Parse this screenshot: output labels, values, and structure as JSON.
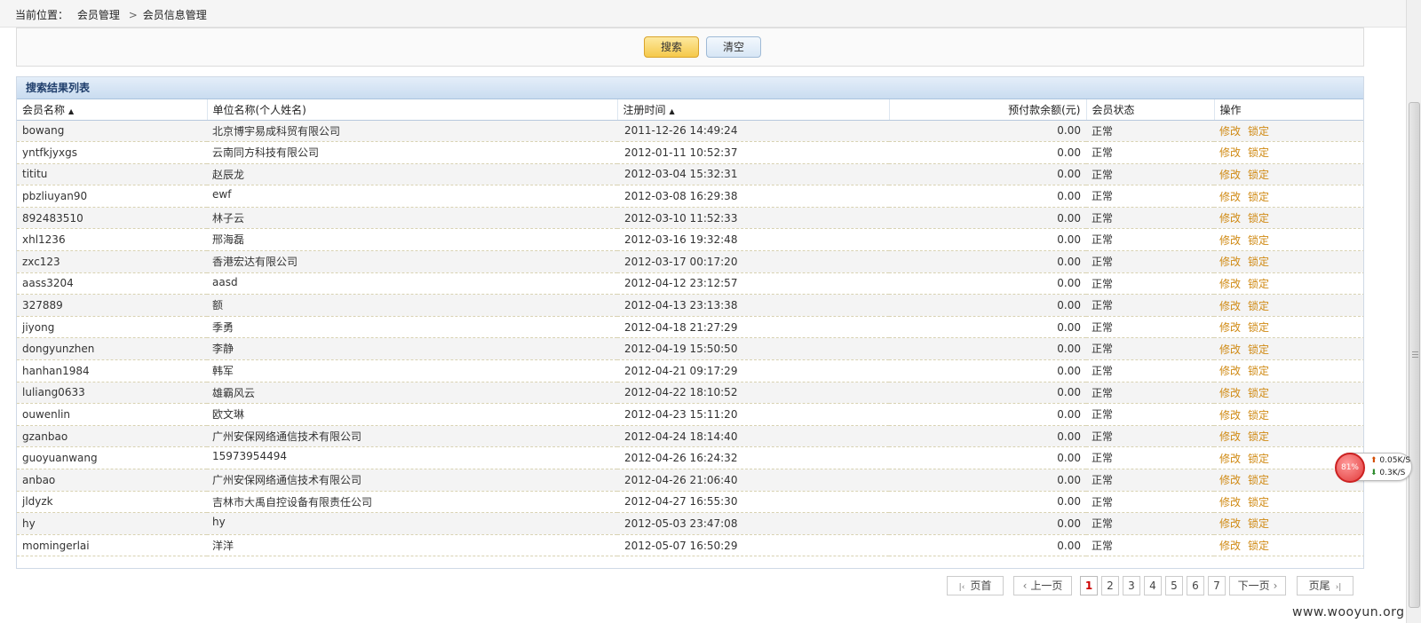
{
  "breadcrumb": {
    "prefix": "当前位置：",
    "items": [
      "会员管理",
      "会员信息管理"
    ],
    "separator": ">"
  },
  "search": {
    "search_label": "搜索",
    "clear_label": "清空"
  },
  "results": {
    "title": "搜索结果列表",
    "columns": {
      "member_name": "会员名称",
      "unit_name": "单位名称(个人姓名)",
      "register_time": "注册时间",
      "balance": "预付款余额(元)",
      "status": "会员状态",
      "actions": "操作"
    },
    "sort_icon": "▲",
    "action_edit": "修改",
    "action_lock": "锁定",
    "rows": [
      {
        "member": "bowang",
        "unit": "北京博宇易成科贸有限公司",
        "time": "2011-12-26 14:49:24",
        "balance": "0.00",
        "status": "正常"
      },
      {
        "member": "yntfkjyxgs",
        "unit": "云南同方科技有限公司",
        "time": "2012-01-11 10:52:37",
        "balance": "0.00",
        "status": "正常"
      },
      {
        "member": "tititu",
        "unit": "赵辰龙",
        "time": "2012-03-04 15:32:31",
        "balance": "0.00",
        "status": "正常"
      },
      {
        "member": "pbzliuyan90",
        "unit": "ewf",
        "time": "2012-03-08 16:29:38",
        "balance": "0.00",
        "status": "正常"
      },
      {
        "member": "892483510",
        "unit": "林子云",
        "time": "2012-03-10 11:52:33",
        "balance": "0.00",
        "status": "正常"
      },
      {
        "member": "xhl1236",
        "unit": "邢海磊",
        "time": "2012-03-16 19:32:48",
        "balance": "0.00",
        "status": "正常"
      },
      {
        "member": "zxc123",
        "unit": "香港宏达有限公司",
        "time": "2012-03-17 00:17:20",
        "balance": "0.00",
        "status": "正常"
      },
      {
        "member": "aass3204",
        "unit": "aasd",
        "time": "2012-04-12 23:12:57",
        "balance": "0.00",
        "status": "正常"
      },
      {
        "member": "327889",
        "unit": "额",
        "time": "2012-04-13 23:13:38",
        "balance": "0.00",
        "status": "正常"
      },
      {
        "member": "jiyong",
        "unit": "季勇",
        "time": "2012-04-18 21:27:29",
        "balance": "0.00",
        "status": "正常"
      },
      {
        "member": "dongyunzhen",
        "unit": "李静",
        "time": "2012-04-19 15:50:50",
        "balance": "0.00",
        "status": "正常"
      },
      {
        "member": "hanhan1984",
        "unit": "韩军",
        "time": "2012-04-21 09:17:29",
        "balance": "0.00",
        "status": "正常"
      },
      {
        "member": "luliang0633",
        "unit": "雄霸风云",
        "time": "2012-04-22 18:10:52",
        "balance": "0.00",
        "status": "正常"
      },
      {
        "member": "ouwenlin",
        "unit": "欧文琳",
        "time": "2012-04-23 15:11:20",
        "balance": "0.00",
        "status": "正常"
      },
      {
        "member": "gzanbao",
        "unit": "广州安保网络通信技术有限公司",
        "time": "2012-04-24 18:14:40",
        "balance": "0.00",
        "status": "正常"
      },
      {
        "member": "guoyuanwang",
        "unit": "15973954494",
        "time": "2012-04-26 16:24:32",
        "balance": "0.00",
        "status": "正常"
      },
      {
        "member": "anbao",
        "unit": "广州安保网络通信技术有限公司",
        "time": "2012-04-26 21:06:40",
        "balance": "0.00",
        "status": "正常"
      },
      {
        "member": "jldyzk",
        "unit": "吉林市大禹自控设备有限责任公司",
        "time": "2012-04-27 16:55:30",
        "balance": "0.00",
        "status": "正常"
      },
      {
        "member": "hy",
        "unit": "hy",
        "time": "2012-05-03 23:47:08",
        "balance": "0.00",
        "status": "正常"
      },
      {
        "member": "momingerlai",
        "unit": "洋洋",
        "time": "2012-05-07 16:50:29",
        "balance": "0.00",
        "status": "正常"
      }
    ]
  },
  "pagination": {
    "first": "页首",
    "prev": "上一页",
    "pages": [
      "1",
      "2",
      "3",
      "4",
      "5",
      "6",
      "7"
    ],
    "current": "1",
    "next": "下一页",
    "last": "页尾",
    "first_icon": "K",
    "prev_icon": "‹",
    "next_icon": "›",
    "last_icon": "ᐳ|"
  },
  "net_widget": {
    "percent": "81%",
    "up": "0.05K/S",
    "down": "0.3K/S"
  },
  "watermark": "www.wooyun.org",
  "colors": {
    "action": "#d08a14",
    "header_text": "#1e3d6b",
    "active_page": "#cc0000"
  }
}
